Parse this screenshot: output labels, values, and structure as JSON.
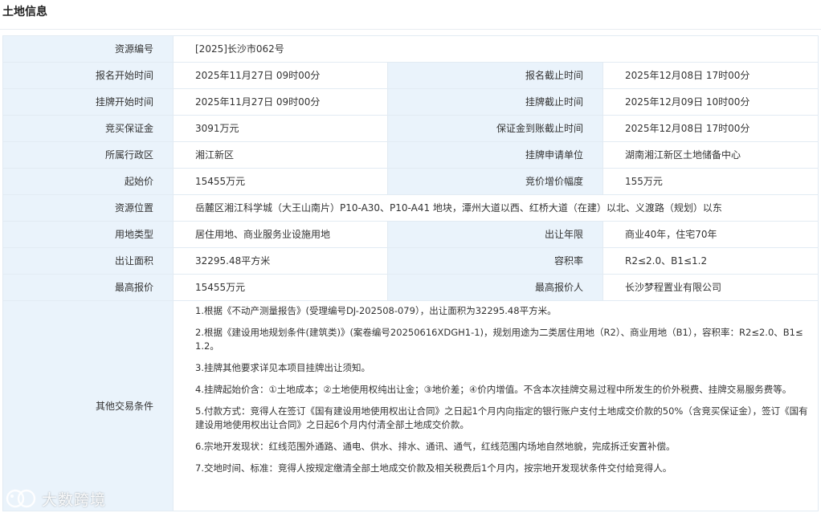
{
  "section_title": "土地信息",
  "rows": [
    {
      "label": "资源编号",
      "value": "[2025]长沙市062号"
    },
    {
      "label": "报名开始时间",
      "value": "2025年11月27日 09时00分",
      "label2": "报名截止时间",
      "value2": "2025年12月08日 17时00分"
    },
    {
      "label": "挂牌开始时间",
      "value": "2025年11月27日 09时00分",
      "label2": "挂牌截止时间",
      "value2": "2025年12月09日 10时00分"
    },
    {
      "label": "竞买保证金",
      "value": "3091万元",
      "label2": "保证金到账截止时间",
      "value2": "2025年12月08日 17时00分"
    },
    {
      "label": "所属行政区",
      "value": "湘江新区",
      "label2": "挂牌申请单位",
      "value2": "湖南湘江新区土地储备中心"
    },
    {
      "label": "起始价",
      "value": "15455万元",
      "label2": "竞价增价幅度",
      "value2": "155万元"
    },
    {
      "label": "资源位置",
      "value": "岳麓区湘江科学城（大王山南片）P10-A30、P10-A41 地块，潭州大道以西、红桥大道（在建）以北、义渡路（规划）以东"
    },
    {
      "label": "用地类型",
      "value": "居住用地、商业服务业设施用地",
      "label2": "出让年限",
      "value2": "商业40年，住宅70年"
    },
    {
      "label": "出让面积",
      "value": "32295.48平方米",
      "label2": "容积率",
      "value2": "R2≤2.0、B1≤1.2"
    },
    {
      "label": "最高报价",
      "value": "15455万元",
      "label2": "最高报价人",
      "value2": "长沙梦程置业有限公司"
    }
  ],
  "conditions": {
    "label": "其他交易条件",
    "items": [
      "1.根据《不动产测量报告》(受理编号DJ-202508-079），出让面积为32295.48平方米。",
      "2.根据《建设用地规划条件(建筑类)》(案卷编号20250616XDGH1-1)，规划用途为二类居住用地（R2）、商业用地（B1），容积率：R2≤2.0、B1≤1.2。",
      "3.挂牌其他要求详见本项目挂牌出让须知。",
      "4.挂牌起始价含：①土地成本；②土地使用权纯出让金；③地价差；④价内增值。不含本次挂牌交易过程中所发生的价外税费、挂牌交易服务费等。",
      "5.付款方式：竞得人在签订《国有建设用地使用权出让合同》之日起1个月内向指定的银行账户支付土地成交价款的50%（含竞买保证金），签订《国有建设用地使用权出让合同》之日起6个月内付清全部土地成交价款。",
      "6.宗地开发现状：红线范围外通路、通电、供水、排水、通讯、通气，红线范围内场地自然地貌，完成拆迁安置补偿。",
      "7.交地时间、标准：竞得人按规定缴清全部土地成交价款及相关税费后1个月内，按宗地开发现状条件交付给竞得人。"
    ]
  },
  "watermark": {
    "text": "大数跨境",
    "icon": "brand-logo-icon"
  }
}
